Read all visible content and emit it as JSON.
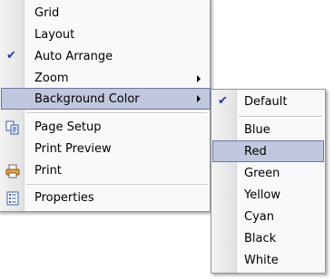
{
  "main_menu": {
    "items": [
      {
        "label": "Grid"
      },
      {
        "label": "Layout"
      },
      {
        "label": "Auto Arrange",
        "checked": true
      },
      {
        "label": "Zoom",
        "submenu": true
      },
      {
        "label": "Background Color",
        "submenu": true,
        "highlighted": true
      },
      {
        "label": "Page Setup",
        "icon": "page-setup-icon"
      },
      {
        "label": "Print Preview"
      },
      {
        "label": "Print",
        "icon": "printer-icon"
      },
      {
        "label": "Properties",
        "icon": "properties-icon"
      }
    ],
    "check_glyph": "✔"
  },
  "submenu": {
    "items": [
      {
        "label": "Default",
        "checked": true
      },
      {
        "label": "Blue"
      },
      {
        "label": "Red",
        "highlighted": true
      },
      {
        "label": "Green"
      },
      {
        "label": "Yellow"
      },
      {
        "label": "Cyan"
      },
      {
        "label": "Black"
      },
      {
        "label": "White"
      }
    ],
    "check_glyph": "✔"
  },
  "colors": {
    "highlight_bg": "#c1c7dd",
    "highlight_border": "#6b73a0",
    "menu_bg": "#f9f9f9",
    "check": "#1a3f9c"
  }
}
